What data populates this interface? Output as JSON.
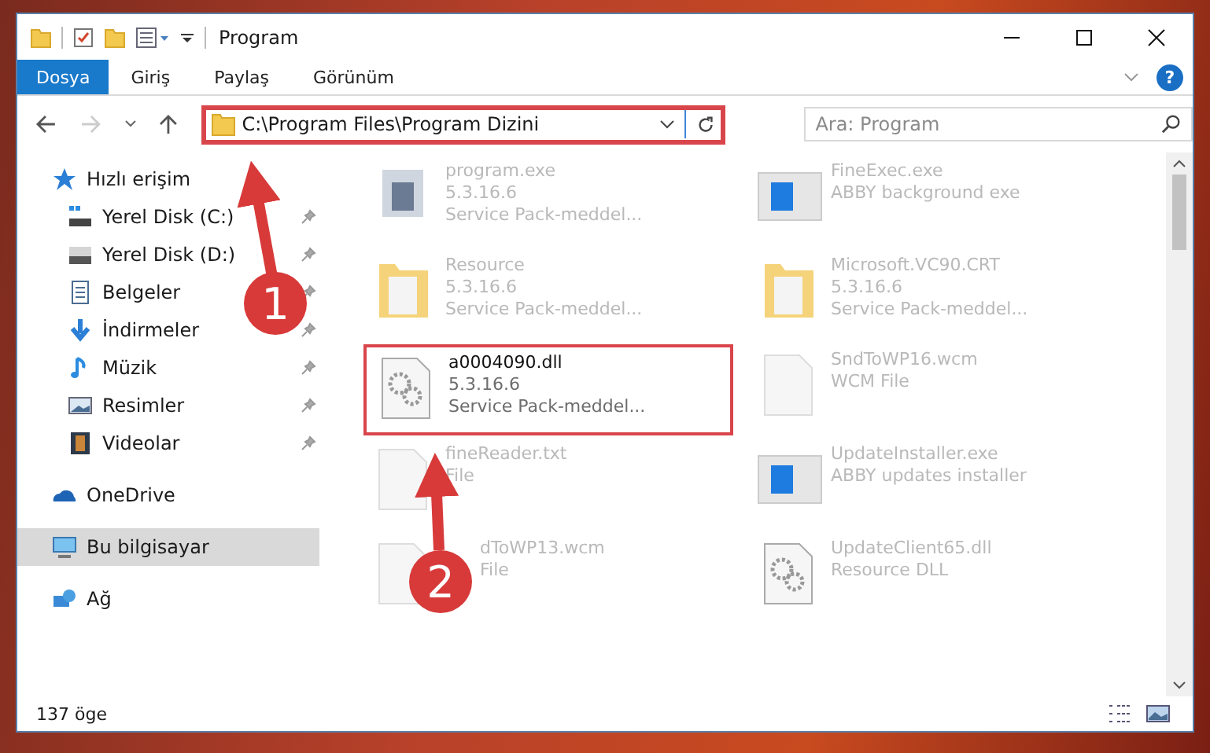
{
  "window": {
    "title": "Program"
  },
  "ribbon_tabs": [
    {
      "label": "Dosya",
      "selected": true
    },
    {
      "label": "Giriş",
      "selected": false
    },
    {
      "label": "Paylaş",
      "selected": false
    },
    {
      "label": "Görünüm",
      "selected": false
    }
  ],
  "help_button": {
    "label": "?"
  },
  "address_bar": {
    "path": "C:\\Program Files\\Program Dizini",
    "highlighted": true
  },
  "search": {
    "placeholder": "Ara: Program"
  },
  "sidebar": {
    "items": [
      {
        "label": "Hızlı erişim",
        "kind": "star",
        "selected": false,
        "children": [
          {
            "label": "Yerel Disk (C:)",
            "kind": "system-drive",
            "selected": false,
            "pinned": true
          },
          {
            "label": "Yerel Disk (D:)",
            "kind": "drive",
            "selected": false,
            "pinned": true
          },
          {
            "label": "Belgeler",
            "kind": "document",
            "selected": false,
            "pinned": true
          },
          {
            "label": "İndirmeler",
            "kind": "download",
            "selected": false,
            "pinned": true
          },
          {
            "label": "Müzik",
            "kind": "music",
            "selected": false,
            "pinned": true
          },
          {
            "label": "Resimler",
            "kind": "pictures",
            "selected": false,
            "pinned": true
          },
          {
            "label": "Videolar",
            "kind": "video",
            "selected": false,
            "pinned": true
          }
        ]
      },
      {
        "label": "OneDrive",
        "kind": "cloud",
        "selected": false
      },
      {
        "label": "Bu bilgisayar",
        "kind": "computer",
        "selected": true
      },
      {
        "label": "Ağ",
        "kind": "network",
        "selected": false
      }
    ]
  },
  "files": [
    {
      "kind": "app",
      "lines": [
        "program.exe",
        "5.3.16.6",
        "Service Pack-meddel..."
      ],
      "highlighted": false,
      "faded": true
    },
    {
      "kind": "window",
      "lines": [
        "FineExec.exe",
        "ABBY background exe"
      ],
      "highlighted": false,
      "faded": true
    },
    {
      "kind": "folder",
      "lines": [
        "Resource",
        "5.3.16.6",
        "Service Pack-meddel..."
      ],
      "highlighted": false,
      "faded": true
    },
    {
      "kind": "folder",
      "lines": [
        "Microsoft.VC90.CRT",
        "5.3.16.6",
        "Service Pack-meddel..."
      ],
      "highlighted": false,
      "faded": true
    },
    {
      "kind": "gears",
      "lines": [
        "a0004090.dll",
        "5.3.16.6",
        "Service Pack-meddel..."
      ],
      "highlighted": true,
      "faded": false
    },
    {
      "kind": "blank",
      "lines": [
        "SndToWP16.wcm",
        "WCM File"
      ],
      "highlighted": false,
      "faded": true
    },
    {
      "kind": "blank",
      "lines": [
        "fineReader.txt",
        "File"
      ],
      "highlighted": false,
      "faded": true
    },
    {
      "kind": "window",
      "lines": [
        "UpdateInstaller.exe",
        "ABBY updates installer"
      ],
      "highlighted": false,
      "faded": true
    },
    {
      "kind": "blank",
      "lines": [
        "dToWP13.wcm",
        "File"
      ],
      "highlighted": false,
      "faded": true
    },
    {
      "kind": "gears",
      "lines": [
        "UpdateClient65.dll",
        "Resource DLL"
      ],
      "highlighted": false,
      "faded": true
    }
  ],
  "status_bar": {
    "count": "137 öge"
  },
  "annotations": [
    {
      "label": "1"
    },
    {
      "label": "2"
    }
  ]
}
